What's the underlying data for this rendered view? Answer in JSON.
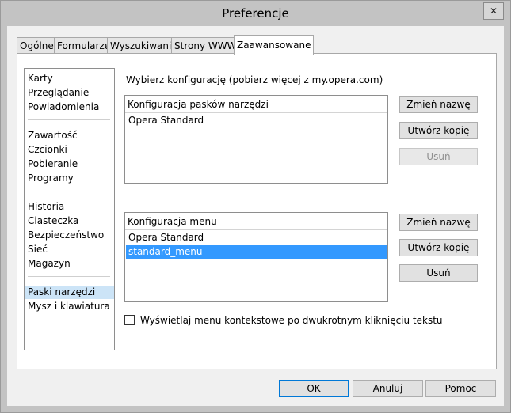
{
  "window": {
    "title": "Preferencje",
    "close_glyph": "✕"
  },
  "tabs": [
    {
      "label": "Ogólne"
    },
    {
      "label": "Formularze"
    },
    {
      "label": "Wyszukiwanie"
    },
    {
      "label": "Strony WWW"
    },
    {
      "label": "Zaawansowane",
      "active": true
    }
  ],
  "sidebar": {
    "selected": "Paski narzędzi",
    "items": [
      "Karty",
      "Przeglądanie",
      "Powiadomienia",
      "Zawartość",
      "Czcionki",
      "Pobieranie",
      "Programy",
      "Historia",
      "Ciasteczka",
      "Bezpieczeństwo",
      "Sieć",
      "Magazyn",
      "Paski narzędzi",
      "Mysz i klawiatura"
    ]
  },
  "content": {
    "instruction": "Wybierz konfigurację (pobierz więcej z my.opera.com)",
    "toolbar_config": {
      "header": "Konfiguracja pasków narzędzi",
      "items": [
        "Opera Standard"
      ],
      "buttons": {
        "rename": "Zmień nazwę",
        "duplicate": "Utwórz kopię",
        "delete": "Usuń"
      },
      "delete_enabled": false
    },
    "menu_config": {
      "header": "Konfiguracja menu",
      "items": [
        "Opera Standard",
        "standard_menu"
      ],
      "selected": "standard_menu",
      "buttons": {
        "rename": "Zmień nazwę",
        "duplicate": "Utwórz kopię",
        "delete": "Usuń"
      },
      "delete_enabled": true
    },
    "checkbox": {
      "label": "Wyświetlaj menu kontekstowe po dwukrotnym kliknięciu tekstu",
      "checked": false
    }
  },
  "footer": {
    "ok": "OK",
    "cancel": "Anuluj",
    "help": "Pomoc"
  },
  "colors": {
    "selection": "#3399ff",
    "nav_selection": "#cce4f7",
    "default_button_border": "#0078d7"
  }
}
